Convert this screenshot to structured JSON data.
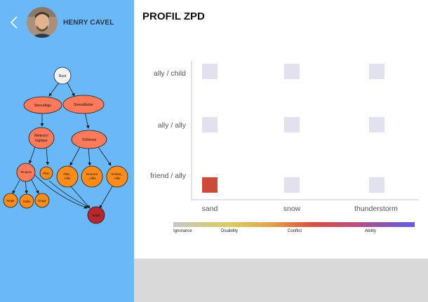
{
  "header": {
    "user_name": "HENRY CAVEL",
    "title": "PROFIL ZPD"
  },
  "tree": {
    "nodes": {
      "root": "Root",
      "stress_aigu": "StressAigu",
      "stress_metier": "StressMetier",
      "meteorologique": "Meteoro logique",
      "tristesse": "TriStesse",
      "tempete": "Tempete",
      "pluie": "Pluie",
      "allie_allie": "Allie_ Allie",
      "ennemi_allie": "Ennemi _Allie",
      "enfant_allie": "Enfant_ Allie",
      "neige": "Neige",
      "sable": "Sable",
      "orage": "Orage",
      "belief": "Belief"
    },
    "colors": {
      "root": "#f2f2f2",
      "stress": "#ff7a5a",
      "leaf": "#ff8c1a",
      "belief": "#b8262e"
    }
  },
  "chart_data": {
    "type": "heatmap",
    "title": "PROFIL ZPD",
    "rows": [
      "ally / child",
      "ally / ally",
      "friend / ally"
    ],
    "columns": [
      "sand",
      "snow",
      "thunderstorm"
    ],
    "cells": [
      {
        "row": "ally / child",
        "column": "sand",
        "level": null
      },
      {
        "row": "ally / child",
        "column": "snow",
        "level": null
      },
      {
        "row": "ally / child",
        "column": "thunderstorm",
        "level": null
      },
      {
        "row": "ally / ally",
        "column": "sand",
        "level": null
      },
      {
        "row": "ally / ally",
        "column": "snow",
        "level": null
      },
      {
        "row": "ally / ally",
        "column": "thunderstorm",
        "level": null
      },
      {
        "row": "friend / ally",
        "column": "sand",
        "level": "Conflict"
      },
      {
        "row": "friend / ally",
        "column": "snow",
        "level": null
      },
      {
        "row": "friend / ally",
        "column": "thunderstorm",
        "level": null
      }
    ],
    "empty_color": "#e2e2ee",
    "level_colors": {
      "Conflict": "#cc4a3a"
    },
    "scale": {
      "labels": [
        "Ignorance",
        "Disability",
        "Conflict",
        "Ability"
      ]
    }
  }
}
